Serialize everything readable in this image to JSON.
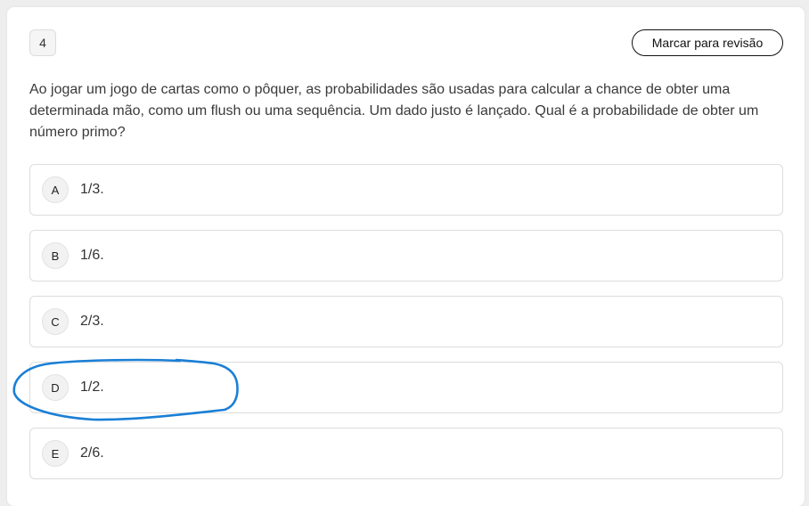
{
  "question": {
    "number": "4",
    "review_label": "Marcar para revisão",
    "text": "Ao jogar um jogo de cartas como o pôquer, as probabilidades são usadas para calcular a chance de obter uma determinada mão, como um flush ou uma sequência. Um dado justo é lançado. Qual é a probabilidade de obter um número primo?"
  },
  "options": [
    {
      "letter": "A",
      "text": "1/3."
    },
    {
      "letter": "B",
      "text": "1/6."
    },
    {
      "letter": "C",
      "text": "2/3."
    },
    {
      "letter": "D",
      "text": "1/2."
    },
    {
      "letter": "E",
      "text": "2/6."
    }
  ],
  "annotation": {
    "color": "#1a7fd6",
    "circled_option": "D"
  }
}
